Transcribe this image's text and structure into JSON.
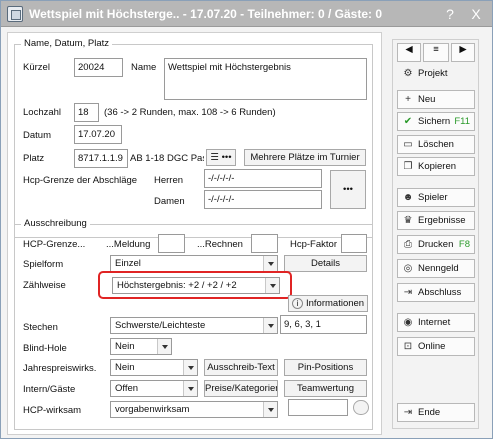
{
  "window": {
    "title": "Wettspiel mit Höchsterge.. - 17.07.20 - Teilnehmer: 0 / Gäste: 0",
    "help": "?",
    "close": "X"
  },
  "group1": {
    "title": "Name, Datum, Platz",
    "kuerzel_label": "Kürzel",
    "kuerzel_value": "20024",
    "name_label": "Name",
    "name_value": "Wettspiel mit Höchstergebnis",
    "lochzahl_label": "Lochzahl",
    "lochzahl_value": "18",
    "lochzahl_hint": "(36 -> 2 Runden, max. 108 -> 6 Runden)",
    "datum_label": "Datum",
    "datum_value": "17.07.20",
    "platz_label": "Platz",
    "platz_value": "8717.1.1.9",
    "platz_desc": "AB 1-18 DGC Passa",
    "more_courses_button": "Mehrere Plätze im Turnier",
    "hcp_limit_label": "Hcp-Grenze der Abschläge",
    "herren_label": "Herren",
    "herren_value": "-/-/-/-/-",
    "damen_label": "Damen",
    "damen_value": "-/-/-/-/-",
    "dots_button": "•••"
  },
  "group2": {
    "title": "Ausschreibung",
    "hcp_grenze_label": "HCP-Grenze...",
    "meldung_label": "...Meldung",
    "rechnen_label": "...Rechnen",
    "hcp_faktor_label": "Hcp-Faktor",
    "spielform_label": "Spielform",
    "spielform_value": "Einzel",
    "details_button": "Details",
    "zaehlweise_label": "Zählweise",
    "zaehlweise_value": "Höchstergebnis: +2 / +2 / +2",
    "info_button": "Informationen",
    "stechen_label": "Stechen",
    "stechen_value": "Schwerste/Leichteste",
    "stechen_extra": "9, 6, 3, 1",
    "blind_label": "Blind-Hole",
    "blind_value": "Nein",
    "jahres_label": "Jahrespreiswirks.",
    "jahres_value": "Nein",
    "ausschreib_button": "Ausschreib-Text",
    "pin_button": "Pin-Positions",
    "intern_label": "Intern/Gäste",
    "intern_value": "Offen",
    "preise_button": "Preise/Kategorien",
    "team_button": "Teamwertung",
    "hcp_wirksam_label": "HCP-wirksam",
    "hcp_wirksam_value": "vorgabenwirksam"
  },
  "sidebar": {
    "nav_prev": "◀",
    "nav_menu": "≡",
    "nav_next": "▶",
    "projekt": "Projekt",
    "neu": "Neu",
    "sichern": "Sichern",
    "sichern_key": "F11",
    "loeschen": "Löschen",
    "kopieren": "Kopieren",
    "spieler": "Spieler",
    "ergebnisse": "Ergebnisse",
    "drucken": "Drucken",
    "drucken_key": "F8",
    "nenngeld": "Nenngeld",
    "abschluss": "Abschluss",
    "internet": "Internet",
    "online": "Online",
    "ende": "Ende"
  },
  "colors": {
    "titlebar": "#b7b7b7",
    "highlight": "#e02424",
    "fkey": "#2a9a2a"
  }
}
